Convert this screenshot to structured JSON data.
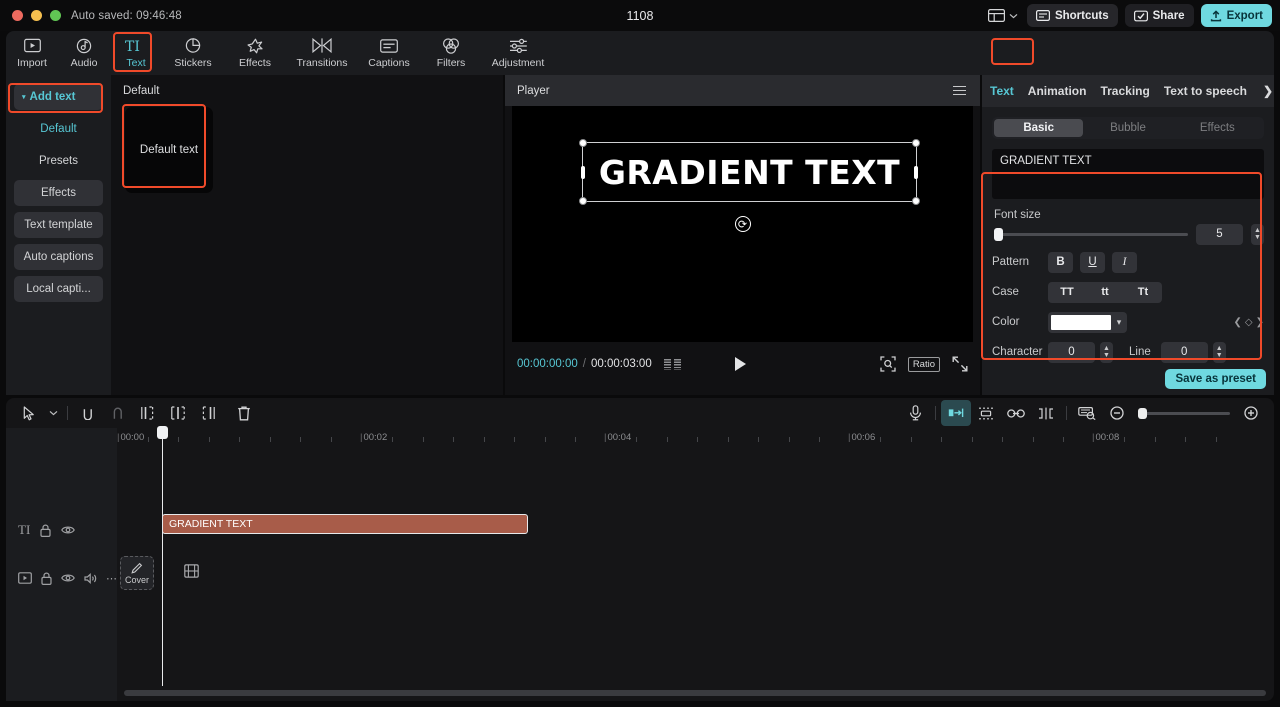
{
  "titlebar": {
    "autosave": "Auto saved: 09:46:48",
    "project_title": "1108",
    "layout_icon": "layout-icon",
    "shortcuts_label": "Shortcuts",
    "share_label": "Share",
    "export_label": "Export"
  },
  "toolbar": {
    "items": [
      {
        "label": "Import",
        "icon": "import-icon"
      },
      {
        "label": "Audio",
        "icon": "audio-icon"
      },
      {
        "label": "Text",
        "icon": "text-icon"
      },
      {
        "label": "Stickers",
        "icon": "stickers-icon"
      },
      {
        "label": "Effects",
        "icon": "effects-icon"
      },
      {
        "label": "Transitions",
        "icon": "transitions-icon"
      },
      {
        "label": "Captions",
        "icon": "captions-icon"
      },
      {
        "label": "Filters",
        "icon": "filters-icon"
      },
      {
        "label": "Adjustment",
        "icon": "adjustment-icon"
      }
    ],
    "active": "Text"
  },
  "sidebar": {
    "items": [
      {
        "label": "Add text"
      },
      {
        "label": "Default"
      },
      {
        "label": "Presets"
      },
      {
        "label": "Effects"
      },
      {
        "label": "Text template"
      },
      {
        "label": "Auto captions"
      },
      {
        "label": "Local capti..."
      }
    ]
  },
  "library": {
    "group_label": "Default",
    "thumb_label": "Default text"
  },
  "player": {
    "title": "Player",
    "menu_icon": "hamburger-icon",
    "canvas_text": "GRADIENT TEXT",
    "rotate_icon": "rotate-icon",
    "current_time": "00:00:00:00",
    "time_separator": "/",
    "total_time": "00:00:03:00",
    "frames_icon": "frames-icon",
    "play_icon": "play-icon",
    "snapshot_icon": "snapshot-icon",
    "ratio_label": "Ratio",
    "fullscreen_icon": "fullscreen-icon"
  },
  "inspector": {
    "tabs": [
      {
        "label": "Text"
      },
      {
        "label": "Animation"
      },
      {
        "label": "Tracking"
      },
      {
        "label": "Text to speech"
      }
    ],
    "active_tab": "Text",
    "scroll_arrow_icon": "chevron-right-icon",
    "segments": [
      {
        "label": "Basic"
      },
      {
        "label": "Bubble"
      },
      {
        "label": "Effects"
      }
    ],
    "active_segment": "Basic",
    "text_value": "GRADIENT TEXT",
    "font_size": {
      "label": "Font size",
      "value": "5"
    },
    "pattern": {
      "label": "Pattern",
      "bold": "B",
      "underline": "U",
      "italic": "I"
    },
    "case": {
      "label": "Case",
      "upper": "TT",
      "lower": "tt",
      "title": "Tt"
    },
    "color": {
      "label": "Color",
      "value": "#FFFFFF",
      "chevron_icon": "chevron-down-icon",
      "keyframe_icon": "keyframe-diamond-icon"
    },
    "character": {
      "label": "Character",
      "value": "0"
    },
    "line": {
      "label": "Line",
      "value": "0"
    },
    "save_preset_label": "Save as preset"
  },
  "timeline": {
    "tools_left": [
      {
        "icon": "pointer-icon"
      },
      {
        "icon": "chevron-down-icon"
      },
      {
        "icon": "undo-icon"
      },
      {
        "icon": "redo-icon"
      },
      {
        "icon": "split-left-icon"
      },
      {
        "icon": "split-icon"
      },
      {
        "icon": "split-right-icon"
      },
      {
        "icon": "delete-icon"
      }
    ],
    "tools_right": [
      {
        "icon": "microphone-icon"
      },
      {
        "icon": "auto-fit-icon"
      },
      {
        "icon": "mirror-icon"
      },
      {
        "icon": "link-icon"
      },
      {
        "icon": "crop-icon"
      },
      {
        "icon": "keyframe-panel-icon"
      },
      {
        "icon": "zoom-out-icon"
      },
      {
        "icon": "zoom-in-icon"
      }
    ],
    "ruler_labels": [
      "00:00",
      "00:02",
      "00:04",
      "00:06",
      "00:08"
    ],
    "text_track": {
      "type_icon": "text-track-icon",
      "lock_icon": "lock-icon",
      "eye_icon": "eye-icon",
      "clip_label": "GRADIENT TEXT"
    },
    "video_track": {
      "type_icon": "video-track-icon",
      "lock_icon": "lock-icon",
      "eye_icon": "eye-icon",
      "audio_icon": "speaker-icon",
      "more_icon": "more-icon",
      "cover_label": "Cover",
      "cover_icon": "pencil-icon",
      "clip_icon": "film-icon"
    }
  },
  "colors": {
    "accent": "#57c7d4",
    "export": "#6fd9e0",
    "highlight_box": "#f04a2a",
    "clip": "#a85c49"
  }
}
